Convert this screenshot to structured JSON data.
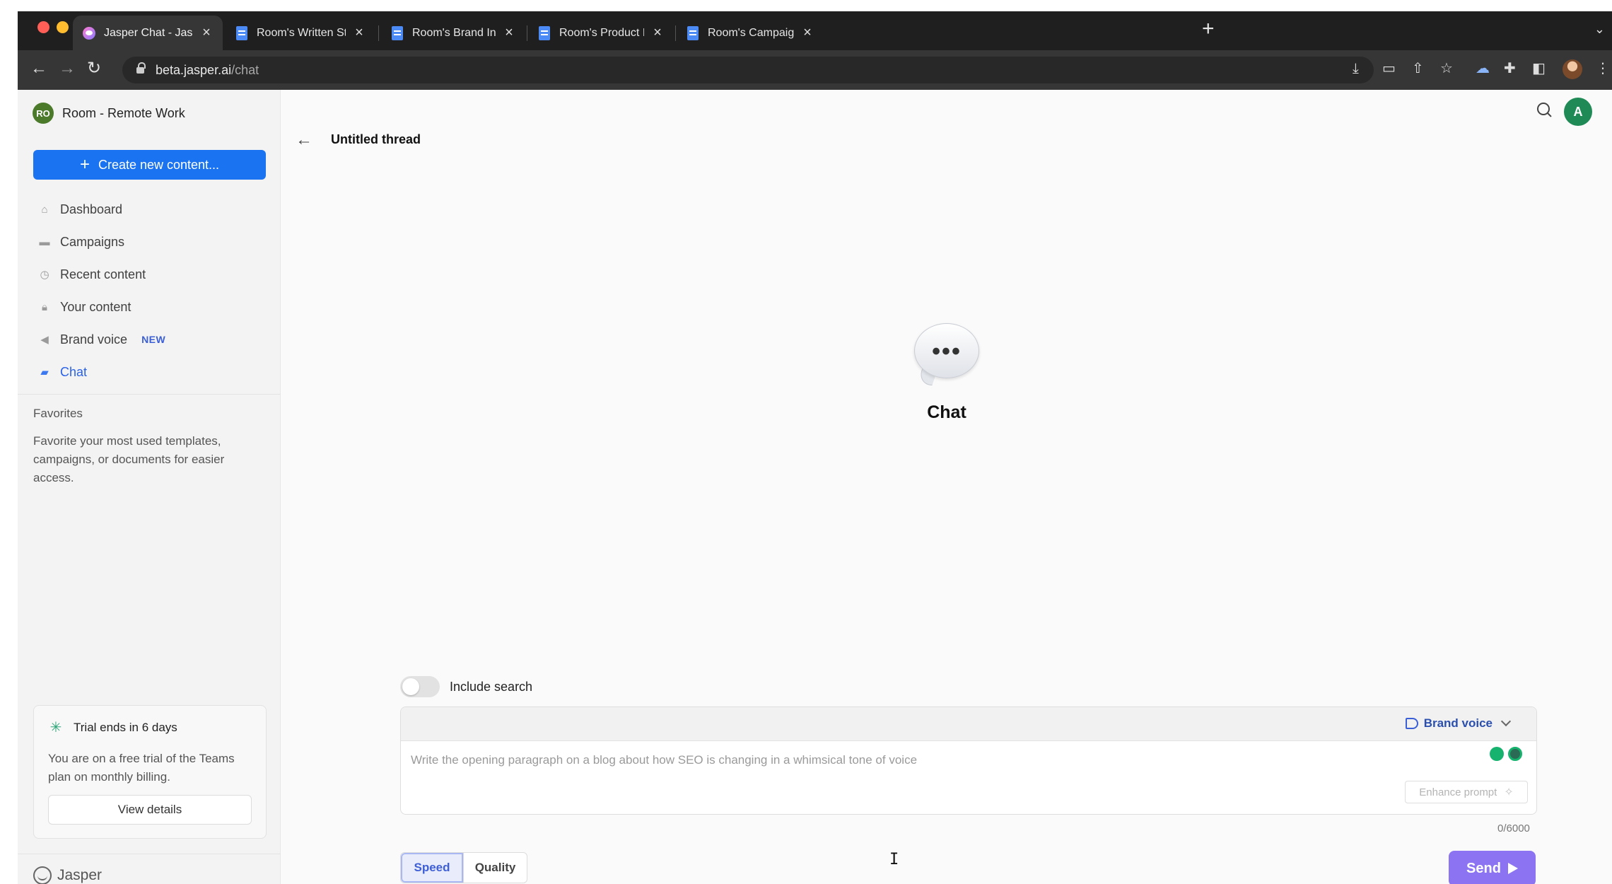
{
  "browser": {
    "tabs": [
      {
        "title": "Jasper Chat - Jasper",
        "icon": "jasper-favicon",
        "active": true
      },
      {
        "title": "Room's Written Style Guide & B",
        "icon": "google-docs-icon"
      },
      {
        "title": "Room's Brand Information - Go",
        "icon": "google-docs-icon"
      },
      {
        "title": "Room's Product Info - Google D",
        "icon": "google-docs-icon"
      },
      {
        "title": "Room's Campaign - The State o",
        "icon": "google-docs-icon"
      }
    ],
    "tab_close_glyph": "×",
    "new_tab_glyph": "+",
    "url_host": "beta.jasper.ai",
    "url_path": "/chat"
  },
  "sidebar": {
    "workspace_initials": "RO",
    "workspace_name": "Room - Remote Work",
    "create_button": "Create new content...",
    "nav": [
      {
        "label": "Dashboard",
        "icon": "home-icon"
      },
      {
        "label": "Campaigns",
        "icon": "folder-icon"
      },
      {
        "label": "Recent content",
        "icon": "clock-icon"
      },
      {
        "label": "Your content",
        "icon": "lock-icon"
      },
      {
        "label": "Brand voice",
        "icon": "megaphone-icon",
        "badge": "NEW"
      },
      {
        "label": "Chat",
        "icon": "chat-icon",
        "active": true
      }
    ],
    "favorites_title": "Favorites",
    "favorites_desc": "Favorite your most used templates, campaigns, or documents for easier access.",
    "trial": {
      "title": "Trial ends in 6 days",
      "text": "You are on a free trial of the Teams plan on monthly billing.",
      "button": "View details"
    },
    "brand_name": "Jasper"
  },
  "header": {
    "avatar_initial": "A",
    "thread_title": "Untitled thread"
  },
  "chat": {
    "empty_title": "Chat",
    "bubble_dots": "•••",
    "include_search_label": "Include search",
    "include_search_on": false,
    "brand_voice_label": "Brand voice",
    "prompt_placeholder": "Write the opening paragraph on a blog about how SEO is changing in a whimsical tone of voice",
    "enhance_label": "Enhance prompt",
    "char_count": "0/6000",
    "modes": [
      "Speed",
      "Quality"
    ],
    "selected_mode": "Speed",
    "send_label": "Send"
  },
  "colors": {
    "primary": "#1a73f0",
    "send": "#8b73f2",
    "active_nav": "#2a62e8",
    "avatar": "#1f8a55"
  }
}
